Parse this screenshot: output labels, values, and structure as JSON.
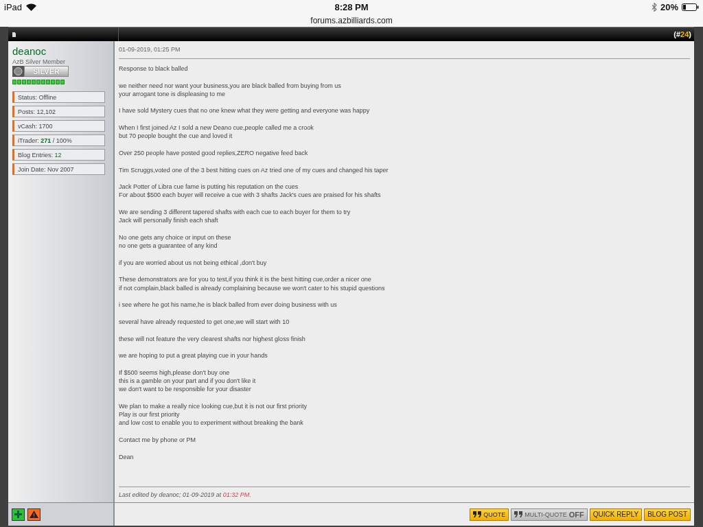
{
  "status_bar": {
    "device": "iPad",
    "time": "8:28 PM",
    "battery": "20%"
  },
  "url": "forums.azbilliards.com",
  "post_header": {
    "prefix": "(#",
    "number": "24",
    "suffix": ")"
  },
  "user": {
    "name": "deanoc",
    "title": "AzB Silver Member",
    "badge": "SILVER",
    "stats": [
      {
        "label": "Status:",
        "value": "Offline",
        "highlight": false,
        "bold": false
      },
      {
        "label": "Posts:",
        "value": "12,102",
        "highlight": false,
        "bold": false
      },
      {
        "label": "vCash:",
        "value": "1700",
        "highlight": false,
        "bold": false
      },
      {
        "label": "iTrader:",
        "value": "271",
        "suffix": "/ 100%",
        "highlight": true,
        "bold": true
      },
      {
        "label": "Blog Entries:",
        "value": "12",
        "highlight": true,
        "bold": false
      },
      {
        "label": "Join Date:",
        "value": "Nov 2007",
        "highlight": false,
        "bold": false
      }
    ]
  },
  "post": {
    "date": "01-09-2019, 01:25 PM",
    "paragraphs": [
      [
        "Response to black balled"
      ],
      [
        "we neither need nor want your business,you are black balled from buying from us",
        "your arrogant tone is displeasing to me"
      ],
      [
        "I have sold Mystery cues that no one knew what they were getting and everyone was happy"
      ],
      [
        "When I first joined Az I sold a new Deano cue,people called me a crook",
        "but 70 people bought the cue and loved it"
      ],
      [
        "Over 250 people have posted good replies,ZERO negative feed back"
      ],
      [
        "Tim Scruggs,voted one of the 3 best hitting cues on Az tried one of my cues and changed his taper"
      ],
      [
        "Jack Potter of Libra cue fame is putting his reputation on the cues",
        "For about $500 each buyer will receive a cue with 3 shafts Jack's cues are praised for his shafts"
      ],
      [
        "We are sending 3 different tapered shafts with each cue to each buyer for them to try",
        "Jack will personally finish each shaft"
      ],
      [
        "No one gets any choice or input on these",
        "no one gets a guarantee of any kind"
      ],
      [
        "if you are worried about us not being ethical ,don't buy"
      ],
      [
        "These demonstrators are for you to test,if you think it is the best hitting cue,order a nicer one",
        "if not complain,black balled is already complaining because we won't cater to his stupid questions"
      ],
      [
        "i see where he got his name,he is black balled from ever doing business with us"
      ],
      [
        "several have already requested to get one,we will start with 10"
      ],
      [
        "these will not feature the very clearest shafts nor highest gloss finish"
      ],
      [
        "we are hoping to put a great playing cue in your hands"
      ],
      [
        "If $500 seems high,please don't buy one",
        "this is a gamble on your part and if you don't like it",
        "we don't want to be responsible for your disaster"
      ],
      [
        "We plan to make a really nice looking cue,but it is not our first priority",
        "Play is our first priority",
        "and low cost to enable you to experiment without breaking the bank"
      ],
      [
        "Contact me by phone or PM"
      ],
      [
        "Dean"
      ]
    ],
    "edited": {
      "text": "Last edited by deanoc; 01-09-2019 at",
      "time": "01:32 PM."
    }
  },
  "buttons": [
    {
      "kind": "quote",
      "label": "QUOTE"
    },
    {
      "kind": "toggle",
      "label": "MULTI-QUOTE",
      "state": "OFF"
    },
    {
      "kind": "plain",
      "label": "QUICK REPLY"
    },
    {
      "kind": "plain",
      "label": "BLOG POST"
    }
  ]
}
